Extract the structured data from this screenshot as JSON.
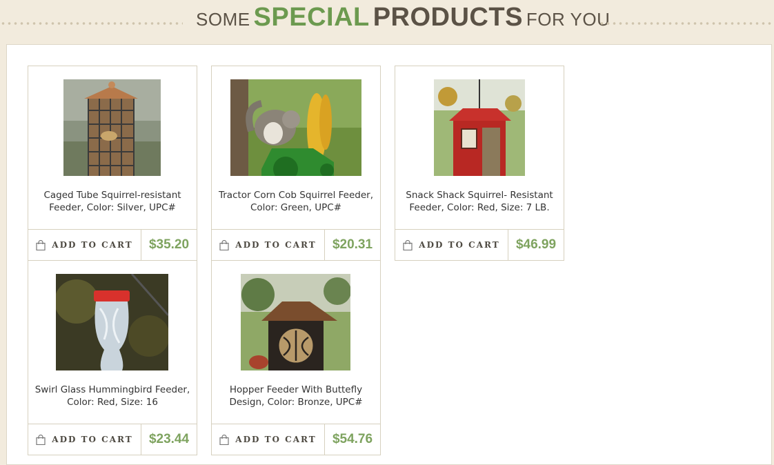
{
  "heading": {
    "part1": "SOME",
    "part2": "SPECIAL",
    "part3": "PRODUCTS",
    "part4": "FOR YOU"
  },
  "colors": {
    "accent_green": "#6c9a4f",
    "price_green": "#7ea35f",
    "heading_brown": "#5b5246",
    "background": "#f2ebdd"
  },
  "products": [
    {
      "name": "Caged Tube Squirrel-resistant Feeder, Color: Silver, UPC#",
      "price": "$35.20",
      "cart_label": "ADD TO CART",
      "image": "caged-tube-feeder"
    },
    {
      "name": "Tractor Corn Cob Squirrel Feeder, Color: Green, UPC#",
      "price": "$20.31",
      "cart_label": "ADD TO CART",
      "image": "tractor-corn-feeder"
    },
    {
      "name": "Snack Shack Squirrel- Resistant Feeder, Color: Red, Size: 7 LB.",
      "price": "$46.99",
      "cart_label": "ADD TO CART",
      "image": "snack-shack-feeder"
    },
    {
      "name": "Swirl Glass Hummingbird Feeder, Color: Red, Size: 16",
      "price": "$23.44",
      "cart_label": "ADD TO CART",
      "image": "hummingbird-feeder"
    },
    {
      "name": "Hopper Feeder With Buttefly Design, Color: Bronze, UPC#",
      "price": "$54.76",
      "cart_label": "ADD TO CART",
      "image": "hopper-butterfly-feeder"
    }
  ]
}
